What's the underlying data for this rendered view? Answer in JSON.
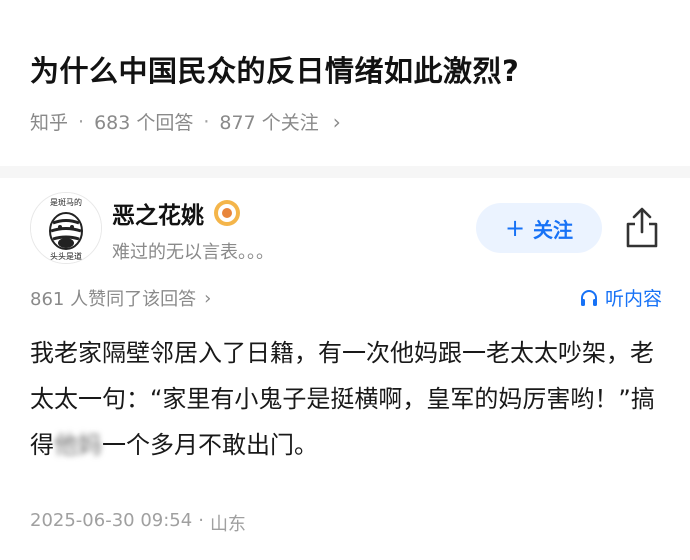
{
  "question": {
    "title": "为什么中国民众的反日情绪如此激烈?",
    "site": "知乎",
    "answers_count": "683 个回答",
    "followers_count": "877 个关注"
  },
  "author": {
    "name": "恶之花姚",
    "bio": "难过的无以言表。。。",
    "follow_label": "关注",
    "avatar_text_top": "是斑马的",
    "avatar_text_bottom": "头头是道"
  },
  "answer": {
    "agree_text": "861 人赞同了该回答",
    "listen_label": "听内容",
    "text_before_blur": "我老家隔壁邻居入了日籍，有一次他妈跟一老太太吵架，老太太一句：“家里有小鬼子是挺横啊，皇军的妈厉害哟！”搞得",
    "blurred_text": "他妈",
    "text_after_blur": "一个多月不敢出门。",
    "date": "2025-06-30 09:54",
    "location": "山东"
  }
}
